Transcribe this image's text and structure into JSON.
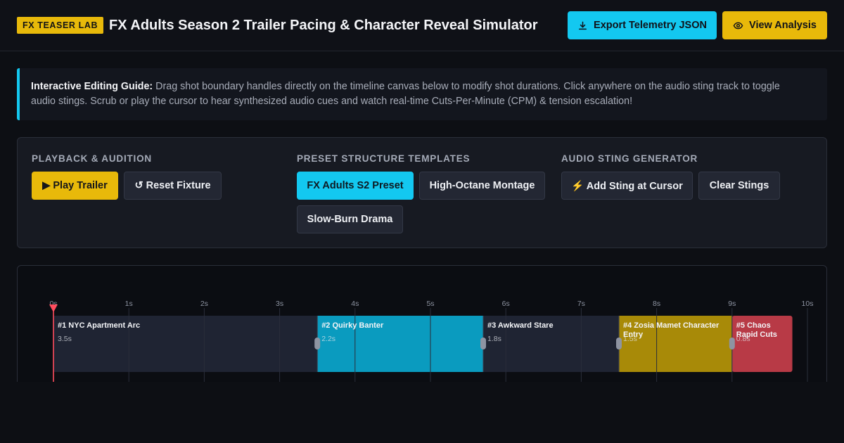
{
  "header": {
    "badge": "FX TEASER LAB",
    "title": "FX Adults Season 2 Trailer Pacing & Character Reveal Simulator",
    "export_label": "Export Telemetry JSON",
    "analysis_label": "View Analysis"
  },
  "guide": {
    "heading": "Interactive Editing Guide:",
    "body": " Drag shot boundary handles directly on the timeline canvas below to modify shot durations. Click anywhere on the audio sting track to toggle audio stings. Scrub or play the cursor to hear synthesized audio cues and watch real-time Cuts-Per-Minute (CPM) & tension escalation!"
  },
  "controls": {
    "playback": {
      "title": "Playback & Audition",
      "play_label": "▶ Play Trailer",
      "reset_label": "↺ Reset Fixture"
    },
    "presets": {
      "title": "Preset Structure Templates",
      "items": [
        "FX Adults S2 Preset",
        "High-Octane Montage",
        "Slow-Burn Drama"
      ]
    },
    "stings": {
      "title": "Audio Sting Generator",
      "add_label": "⚡ Add Sting at Cursor",
      "clear_label": "Clear Stings"
    }
  },
  "timeline": {
    "ticks": [
      "0s",
      "1s",
      "2s",
      "3s",
      "4s",
      "5s",
      "6s",
      "7s",
      "8s",
      "9s",
      "10s"
    ],
    "cursor_time": 0,
    "shots": [
      {
        "title_lines": [
          "#1 NYC Apartment Arc"
        ],
        "duration": 3.5,
        "duration_label": "3.5s",
        "color": "#1f2433"
      },
      {
        "title_lines": [
          "#2 Quirky Banter"
        ],
        "duration": 2.2,
        "duration_label": "2.2s",
        "color": "#0a9bbf"
      },
      {
        "title_lines": [
          "#3 Awkward Stare"
        ],
        "duration": 1.8,
        "duration_label": "1.8s",
        "color": "#1f2433"
      },
      {
        "title_lines": [
          "#4 Zosia Mamet Character",
          "Entry"
        ],
        "duration": 1.5,
        "duration_label": "1.5s",
        "color": "#a88a08"
      },
      {
        "title_lines": [
          "#5 Chaos",
          "Rapid Cuts"
        ],
        "duration": 0.8,
        "duration_label": "0.8s",
        "color": "#b83a46"
      }
    ],
    "colors": {
      "cursor": "#ff4d5e",
      "grid": "#2a2e3a",
      "tick_text": "#8e94a2",
      "handle": "#8e94a2"
    }
  }
}
